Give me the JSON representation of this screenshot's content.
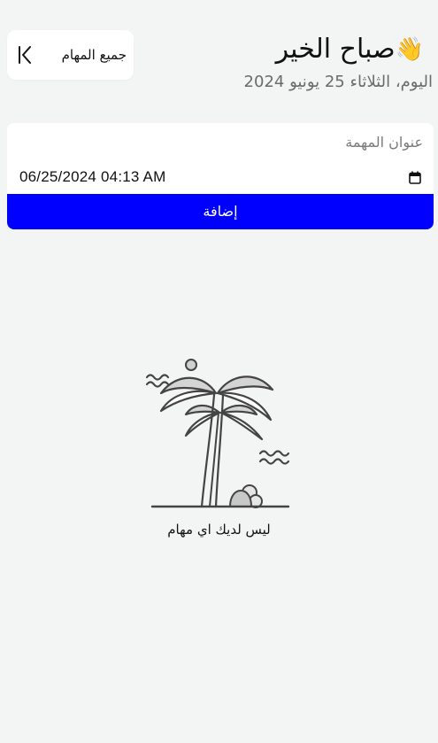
{
  "header": {
    "greeting": "صباح الخير",
    "greeting_emoji": "👋",
    "date_line": "اليوم، الثلاثاء 25 يونيو 2024",
    "all_tasks_label": "جميع المهام",
    "back_icon": "bar-chevron-left-icon"
  },
  "form": {
    "title_placeholder": "عنوان المهمة",
    "datetime_value": "06/25/2024  04:13  AM",
    "calendar_icon": "calendar-icon",
    "add_label": "إضافة"
  },
  "empty_state": {
    "illustration": "palm-tree-illustration",
    "message": "ليس لديك اي مهام"
  },
  "colors": {
    "accent": "#0000ff",
    "background": "#f3f4f4",
    "card": "#ffffff",
    "muted_text": "#6b6b6b"
  }
}
